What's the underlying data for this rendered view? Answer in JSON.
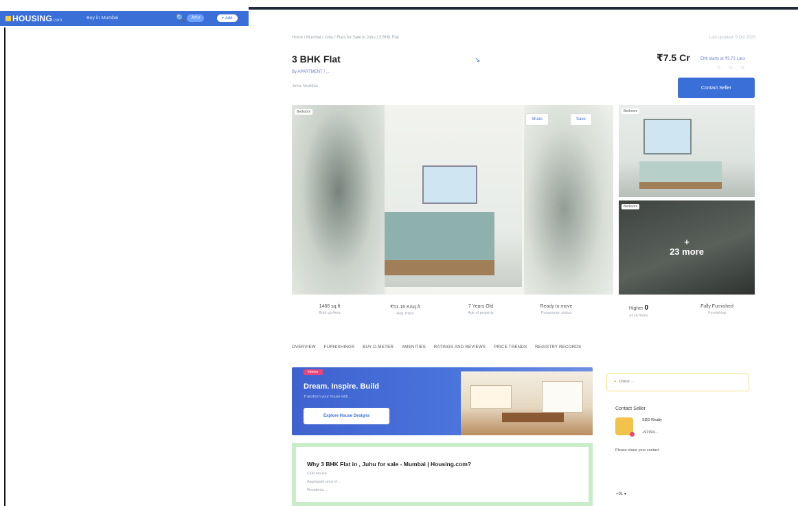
{
  "header": {
    "logo": "HOUSING",
    "logo_suffix": ".com",
    "city": "Buy in Mumbai",
    "chip_1": "Juhu",
    "chip_2": "+ Add"
  },
  "breadcrumb": "Home / Mumbai / Juhu / Flats for Sale in Juhu / 3 BHK Flat",
  "breadcrumb_right": "Last updated: 9 Oct 2023",
  "listing": {
    "title": "3 BHK Flat",
    "byline": "By APARTMENT / ...",
    "address": "Juhu, Mumbai",
    "price": "₹7.5 Cr",
    "emi": "EMI starts at ₹3.72 Lacs",
    "contact_button": "Contact Seller"
  },
  "gallery": {
    "tag_1": "Bedroom",
    "tag_2": "Bedroom",
    "tag_3": "Bedroom",
    "share": "Share",
    "save": "Save",
    "more_plus": "+",
    "more_text": "23 more"
  },
  "stats": [
    {
      "value": "1466 sq.ft",
      "label": "Built up Area"
    },
    {
      "value": "₹51.16 K/sq.ft",
      "label": "Avg. Price"
    },
    {
      "value": "7 Years Old",
      "label": "Age of property"
    },
    {
      "value": "Ready to move",
      "label": "Possession status"
    },
    {
      "value": "Higher",
      "value_bold": "0",
      "label": "of 16 floors"
    },
    {
      "value": "Fully Furnished",
      "label": "Furnishing"
    }
  ],
  "tabs": [
    "OVERVIEW",
    "FURNISHINGS",
    "BUY-O-METER",
    "AMENITIES",
    "RATINGS AND REVIEWS",
    "PRICE TRENDS",
    "REGISTRY RECORDS"
  ],
  "banner": {
    "badge": "Interior",
    "heading": "Dream. Inspire. Build",
    "subtext": "Transform your house with ...",
    "cta": "Explore House Designs"
  },
  "why": {
    "heading": "Why 3 BHK Flat in , Juhu for sale - Mumbai | Housing.com?",
    "items": [
      "Club House",
      "Aggregate area of ...",
      "Residents ..."
    ]
  },
  "side": {
    "note": "Check ...",
    "contact_title": "Contact Seller",
    "seller_name": "SDD Realty",
    "seller_sub": "...",
    "seller_phone": "+91994...",
    "prompt": "Please share your contact",
    "country_code": "+91 ▾"
  },
  "colors": {
    "brand_blue": "#3b6fd8",
    "accent_pink": "#e8457a",
    "note_border": "#f1e38a",
    "why_border": "#c9ecc9"
  }
}
